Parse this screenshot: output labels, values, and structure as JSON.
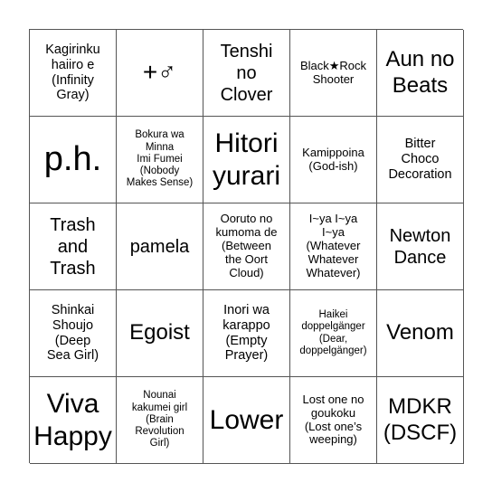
{
  "board": {
    "cells": [
      {
        "text": "Kagirinku\nhaiiro e\n(Infinity\nGray)",
        "size": "s2"
      },
      {
        "text": "+♂",
        "size": "s7"
      },
      {
        "text": "Tenshi\nno\nClover",
        "size": "s3"
      },
      {
        "text": "Black★Rock\nShooter",
        "size": "s1"
      },
      {
        "text": "Aun no\nBeats",
        "size": "s4"
      },
      {
        "text": "p.h.",
        "size": "s6"
      },
      {
        "text": "Bokura wa\nMinna\nImi Fumei\n(Nobody\nMakes Sense)",
        "size": "xs"
      },
      {
        "text": "Hitori\nyurari",
        "size": "s5"
      },
      {
        "text": "Kamippoina\n(God-ish)",
        "size": "s1"
      },
      {
        "text": "Bitter\nChoco\nDecoration",
        "size": "s2"
      },
      {
        "text": "Trash\nand\nTrash",
        "size": "s3"
      },
      {
        "text": "pamela",
        "size": "s3"
      },
      {
        "text": "Ooruto no\nkumoma de\n(Between\nthe Oort\nCloud)",
        "size": "s1"
      },
      {
        "text": "I~ya I~ya\nI~ya\n(Whatever\nWhatever\nWhatever)",
        "size": "s1"
      },
      {
        "text": "Newton\nDance",
        "size": "s3"
      },
      {
        "text": "Shinkai\nShoujo\n(Deep\nSea Girl)",
        "size": "s2"
      },
      {
        "text": "Egoist",
        "size": "s4"
      },
      {
        "text": "Inori wa\nkarappo\n(Empty\nPrayer)",
        "size": "s2"
      },
      {
        "text": "Haikei\ndoppelgänger\n(Dear,\ndoppelgänger)",
        "size": "xs"
      },
      {
        "text": "Venom",
        "size": "s4"
      },
      {
        "text": "Viva\nHappy",
        "size": "s5"
      },
      {
        "text": "Nounai\nkakumei girl\n(Brain\nRevolution\nGirl)",
        "size": "xs"
      },
      {
        "text": "Lower",
        "size": "s5"
      },
      {
        "text": "Lost one no\ngoukoku\n(Lost one’s\nweeping)",
        "size": "s1"
      },
      {
        "text": "MDKR\n(DSCF)",
        "size": "s4"
      }
    ]
  },
  "colors": {
    "grid_line": "#555555",
    "background": "#ffffff",
    "text": "#000000"
  }
}
